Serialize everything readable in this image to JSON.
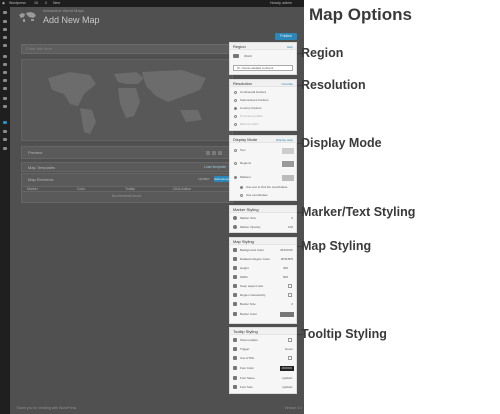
{
  "admin_bar": {
    "site": "Wordpress",
    "comments": "15",
    "updates": "0",
    "new": "New",
    "account": "Howdy, admin"
  },
  "page": {
    "breadcrumb": "Interactive World Maps",
    "title": "Add New Map",
    "publish": "Publish",
    "title_placeholder": "Enter title here"
  },
  "preview": {
    "label": "Preview"
  },
  "templates": {
    "label": "Map Templates",
    "link": "Load template"
  },
  "elements": {
    "label": "Map Elements",
    "action1": "Update",
    "action2": "Add element",
    "columns": [
      "Marker",
      "Color",
      "Tooltip",
      "Click Action"
    ],
    "empty": "No elements found."
  },
  "footer": {
    "left": "Thank you for creating with WordPress.",
    "right": "Version 4.x"
  },
  "main_title": "Map Options",
  "sections": {
    "region": "Region",
    "resolution": "Resolution",
    "display_mode": "Display Mode",
    "marker_text": "Marker/Text Styling",
    "map_styling": "Map Styling",
    "tooltip": "Tooltip Styling"
  },
  "panels": {
    "region": {
      "title": "Region",
      "link": "Help",
      "current": "World",
      "select": "Or, choose detailed continent"
    },
    "resolution": {
      "title": "Resolution",
      "link": "Override",
      "options": [
        "Continental borders",
        "Subcontinent borders",
        "Country borders",
        "Province borders",
        "Metro borders"
      ]
    },
    "display": {
      "title": "Display Mode",
      "link": "Display Help",
      "options": [
        "Text",
        "Regions",
        "Markers"
      ],
      "sub": [
        "Use text to find the coordinates",
        "Use coordinates"
      ]
    },
    "marker": {
      "title": "Marker Styling",
      "rows": [
        {
          "label": "Marker Size",
          "value": "6"
        },
        {
          "label": "Marker Opacity",
          "value": "100"
        }
      ]
    },
    "map": {
      "title": "Map Styling",
      "rows": [
        {
          "label": "Background Color",
          "value": "#FFFFFF"
        },
        {
          "label": "Dataless Region Color",
          "value": "#F5F5F5"
        },
        {
          "label": "Height",
          "value": "300"
        },
        {
          "label": "Width",
          "value": "600"
        },
        {
          "label": "Keep aspect ratio",
          "value": ""
        },
        {
          "label": "Region interactivity",
          "value": ""
        },
        {
          "label": "Border Size",
          "value": "0"
        },
        {
          "label": "Border Color",
          "value": ""
        }
      ]
    },
    "tooltip": {
      "title": "Tooltip Styling",
      "rows": [
        {
          "label": "Show tooltips",
          "value": ""
        },
        {
          "label": "Trigger",
          "value": "Hover"
        },
        {
          "label": "Use HTML",
          "value": ""
        },
        {
          "label": "Font Color",
          "value": "#000000"
        },
        {
          "label": "Font Name",
          "value": "<global>"
        },
        {
          "label": "Font Size",
          "value": "<global>"
        }
      ]
    }
  }
}
